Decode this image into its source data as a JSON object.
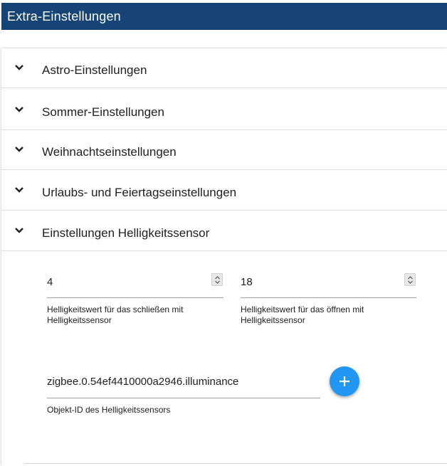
{
  "header": {
    "title": "Extra-Einstellungen"
  },
  "sections": [
    {
      "label": "Astro-Einstellungen"
    },
    {
      "label": "Sommer-Einstellungen"
    },
    {
      "label": "Weihnachtseinstellungen"
    },
    {
      "label": "Urlaubs- und Feiertagseinstellungen"
    },
    {
      "label": "Einstellungen Helligkeitssensor"
    }
  ],
  "brightness": {
    "close_value": "4",
    "close_help_line1": "Helligkeitswert für das schließen mit",
    "close_help_line2": "Helligkeitssensor",
    "open_value": "18",
    "open_help_line1": "Helligkeitswert für das öffnen mit",
    "open_help_line2": "Helligkeitssensor",
    "object_id": "zigbee.0.54ef4410000a2946.illuminance",
    "object_id_help": "Objekt-ID des Helligkeitssensors"
  },
  "colors": {
    "header_bg": "#164477",
    "fab": "#2196f3"
  },
  "icons": {
    "section_toggle": "chevron-down-icon",
    "spinner": "spinner-arrows-icon",
    "add": "plus-icon"
  }
}
